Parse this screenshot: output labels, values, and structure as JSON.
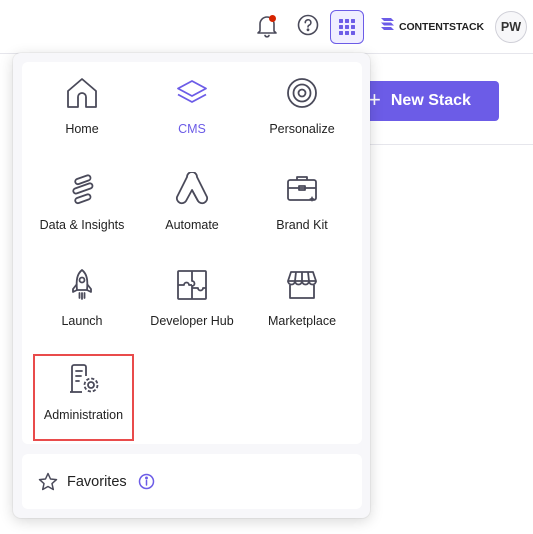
{
  "topbar": {
    "notifications_icon": "bell-icon",
    "help_icon": "help-circle-icon",
    "apps_icon": "grid-icon",
    "brand": {
      "logo_icon": "contentstack-logo-icon",
      "name": "CONTENTSTACK"
    },
    "avatar_initials": "PW"
  },
  "background": {
    "new_stack_label": "New Stack"
  },
  "app_switcher": {
    "apps": [
      {
        "label": "Home",
        "icon": "home-icon"
      },
      {
        "label": "CMS",
        "icon": "layers-icon",
        "active": true
      },
      {
        "label": "Personalize",
        "icon": "target-icon"
      },
      {
        "label": "Data & Insights",
        "icon": "data-insights-icon"
      },
      {
        "label": "Automate",
        "icon": "automate-icon"
      },
      {
        "label": "Brand Kit",
        "icon": "brand-kit-icon"
      },
      {
        "label": "Launch",
        "icon": "rocket-icon"
      },
      {
        "label": "Developer Hub",
        "icon": "puzzle-icon"
      },
      {
        "label": "Marketplace",
        "icon": "storefront-icon"
      },
      {
        "label": "Administration",
        "icon": "admin-settings-icon",
        "highlighted": true
      }
    ],
    "favorites_label": "Favorites",
    "favorites_icon": "star-icon",
    "info_icon": "info-icon"
  },
  "colors": {
    "accent": "#6c5ce7",
    "highlight_border": "#e94b4b",
    "notification_dot": "#d62400"
  }
}
